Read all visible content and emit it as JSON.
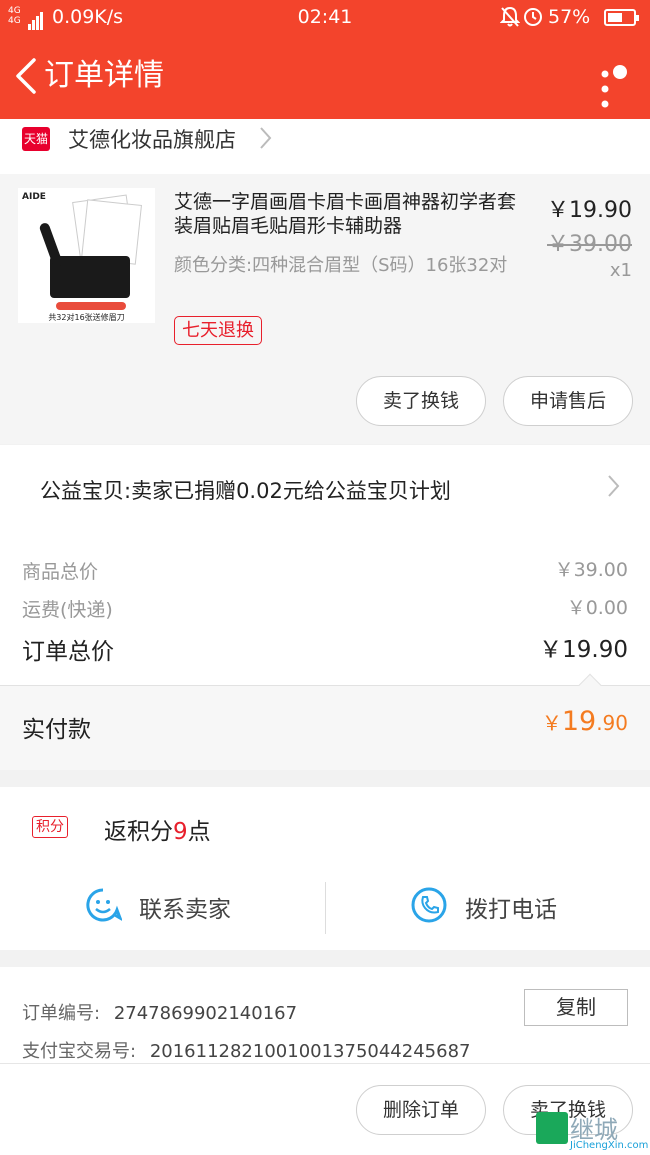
{
  "status_bar": {
    "network": "4G 4G",
    "speed": "0.09K/s",
    "time": "02:41",
    "battery": "57%",
    "battery_level": 0.57
  },
  "header": {
    "title": "订单详情"
  },
  "store": {
    "badge": "天猫",
    "name": "艾德化妆品旗舰店"
  },
  "product": {
    "thumb_brand": "AIDE",
    "thumb_caption": "共32对16张送修眉刀",
    "title": "艾德一字眉画眉卡眉卡画眉神器初学者套装眉贴眉毛贴眉形卡辅助器",
    "spec": "颜色分类:四种混合眉型（S码）16张32对",
    "badge": "七天退换",
    "price": "￥19.90",
    "original_price": "￥39.00",
    "quantity": "x1",
    "btn_sell": "卖了换钱",
    "btn_after_sale": "申请售后"
  },
  "charity": {
    "text": "公益宝贝:卖家已捐赠0.02元给公益宝贝计划"
  },
  "summary": {
    "goods_total_label": "商品总价",
    "goods_total_value": "￥39.00",
    "shipping_label": "运费(快递)",
    "shipping_value": "￥0.00",
    "order_total_label": "订单总价",
    "order_total_value": "￥19.90",
    "paid_label": "实付款",
    "paid_currency": "￥",
    "paid_int": "19",
    "paid_dec": ".90"
  },
  "points": {
    "badge": "积分",
    "text_prefix": "返积分",
    "number": "9",
    "text_suffix": "点"
  },
  "contact": {
    "seller": "联系卖家",
    "phone": "拨打电话"
  },
  "order_info": {
    "order_no_label": "订单编号:",
    "order_no": "2747869902140167",
    "copy": "复制",
    "alipay_label": "支付宝交易号:",
    "alipay_no": "2016112821001001375044245687"
  },
  "bottom": {
    "delete": "删除订单",
    "sell": "卖了换钱"
  },
  "watermark": {
    "text": "继城",
    "sub": "JiChengXin.com"
  },
  "colors": {
    "brand_red": "#f3442c",
    "accent_orange": "#f47b20",
    "tmall_red": "#e8002d"
  }
}
